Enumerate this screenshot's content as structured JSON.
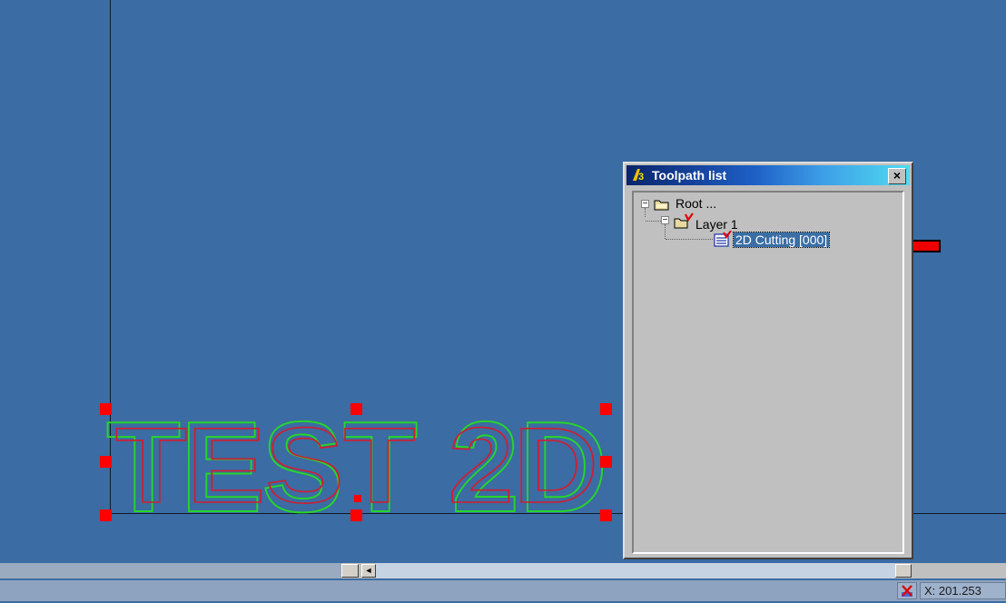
{
  "canvas": {
    "drawing_text": "TEST 2D",
    "background_color": "#3b6ca3",
    "outline_outer_color": "#27d52a",
    "outline_inner_color": "#d11d2f",
    "handle_color": "#ff0000"
  },
  "toolpath_window": {
    "title": "Toolpath list",
    "close_label": "×",
    "tree": {
      "root_label": "Root ...",
      "layer_label": "Layer 1",
      "toolpath_label": "2D Cutting [000]"
    }
  },
  "annotation": {
    "arrow_color": "#ee0000",
    "icon": "red-arrow-icon"
  },
  "status_bar": {
    "coordinate": "X: 201.253"
  },
  "icons": [
    "app-logo-icon",
    "close-icon",
    "expand-collapse-icon",
    "folder-icon",
    "layer-folder-icon",
    "toolpath-icon",
    "red-arrow-icon",
    "scroll-left-icon",
    "status-cross-icon"
  ]
}
